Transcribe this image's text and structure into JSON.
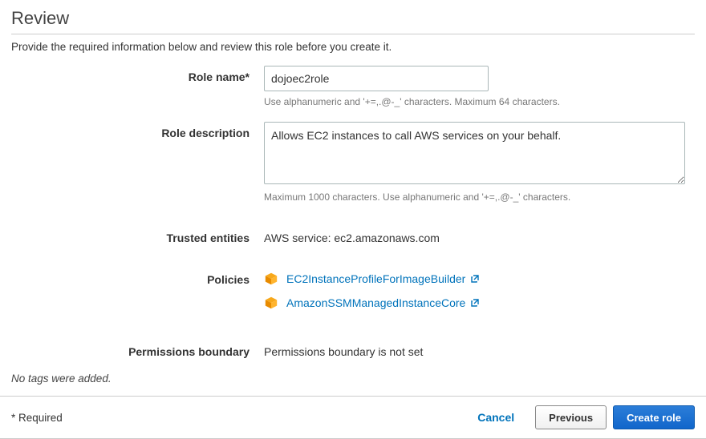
{
  "heading": "Review",
  "intro": "Provide the required information below and review this role before you create it.",
  "roleName": {
    "label": "Role name*",
    "value": "dojoec2role",
    "hint": "Use alphanumeric and '+=,.@-_' characters. Maximum 64 characters."
  },
  "roleDescription": {
    "label": "Role description",
    "value": "Allows EC2 instances to call AWS services on your behalf.",
    "hint": "Maximum 1000 characters. Use alphanumeric and '+=,.@-_' characters."
  },
  "trustedEntities": {
    "label": "Trusted entities",
    "value": "AWS service: ec2.amazonaws.com"
  },
  "policies": {
    "label": "Policies",
    "items": [
      {
        "name": "EC2InstanceProfileForImageBuilder"
      },
      {
        "name": "AmazonSSMManagedInstanceCore"
      }
    ]
  },
  "permissionsBoundary": {
    "label": "Permissions boundary",
    "value": "Permissions boundary is not set"
  },
  "noTags": "No tags were added.",
  "footer": {
    "requiredNote": "* Required",
    "cancel": "Cancel",
    "previous": "Previous",
    "create": "Create role"
  }
}
